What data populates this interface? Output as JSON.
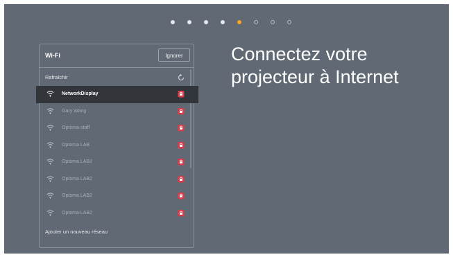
{
  "progress": {
    "steps": [
      {
        "state": "done"
      },
      {
        "state": "done"
      },
      {
        "state": "done"
      },
      {
        "state": "done"
      },
      {
        "state": "active"
      },
      {
        "state": "todo"
      },
      {
        "state": "todo"
      },
      {
        "state": "todo"
      }
    ],
    "current_step": 5,
    "total_steps": 8
  },
  "heading": {
    "line1": "Connectez votre",
    "line2": "projecteur à Internet"
  },
  "wifi_panel": {
    "title": "Wi-Fi",
    "ignore_label": "Ignorer",
    "refresh_label": "Rafraîchir",
    "add_network_label": "Ajouter un nouveau réseau",
    "networks": [
      {
        "name": "NetworkDisplay",
        "secured": true,
        "selected": true
      },
      {
        "name": "Gary Wang",
        "secured": true,
        "selected": false
      },
      {
        "name": "Optoma-staff",
        "secured": true,
        "selected": false
      },
      {
        "name": "Optoma LAB",
        "secured": true,
        "selected": false
      },
      {
        "name": "Optoma LAB2",
        "secured": true,
        "selected": false
      },
      {
        "name": "Optoma LAB2",
        "secured": true,
        "selected": false
      },
      {
        "name": "Optoma LAB2",
        "secured": true,
        "selected": false
      },
      {
        "name": "Optoma LAB2",
        "secured": true,
        "selected": false
      }
    ]
  },
  "colors": {
    "background": "#616a74",
    "accent": "#f5a623",
    "selected_row": "#323539",
    "lock": "#e0394a"
  },
  "icons": {
    "wifi": "wifi-icon",
    "lock": "lock-icon",
    "refresh": "refresh-icon"
  }
}
